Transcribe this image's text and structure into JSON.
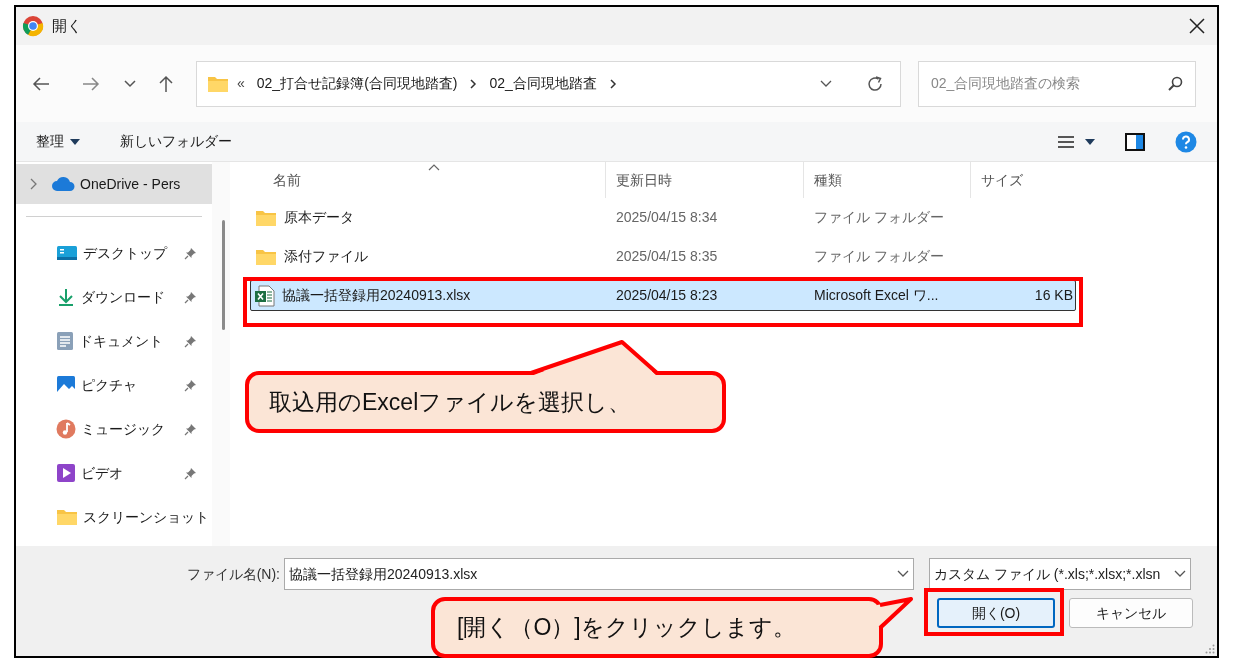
{
  "window": {
    "title": "開く"
  },
  "nav": {
    "prefix": "«",
    "breadcrumb": [
      {
        "label": "02_打合せ記録簿(合同現地踏査)"
      },
      {
        "label": "02_合同現地踏査"
      }
    ],
    "search": {
      "placeholder": "02_合同現地踏査の検索"
    }
  },
  "toolbar": {
    "organize": "整理",
    "new_folder": "新しいフォルダー"
  },
  "sidebar": {
    "items": [
      {
        "label": "OneDrive - Pers",
        "kind": "cloud",
        "selected": true,
        "pinned": false
      },
      {
        "label": "デスクトップ",
        "kind": "desktop",
        "selected": false,
        "pinned": true
      },
      {
        "label": "ダウンロード",
        "kind": "download",
        "selected": false,
        "pinned": true
      },
      {
        "label": "ドキュメント",
        "kind": "document",
        "selected": false,
        "pinned": true
      },
      {
        "label": "ピクチャ",
        "kind": "picture",
        "selected": false,
        "pinned": true
      },
      {
        "label": "ミュージック",
        "kind": "music",
        "selected": false,
        "pinned": true
      },
      {
        "label": "ビデオ",
        "kind": "video",
        "selected": false,
        "pinned": true
      },
      {
        "label": "スクリーンショット",
        "kind": "folder",
        "selected": false,
        "pinned": false
      }
    ]
  },
  "table": {
    "columns": [
      "名前",
      "更新日時",
      "種類",
      "サイズ"
    ],
    "rows": [
      {
        "name": "原本データ",
        "kind": "folder",
        "modified": "2025/04/15 8:34",
        "type": "ファイル フォルダー",
        "selected": false
      },
      {
        "name": "添付ファイル",
        "kind": "folder",
        "modified": "2025/04/15 8:35",
        "type": "ファイル フォルダー",
        "selected": false
      },
      {
        "name": "協議一括登録用20240913.xlsx",
        "kind": "excel",
        "modified": "2025/04/15 8:23",
        "type": "Microsoft Excel ワ...",
        "size": "16 KB",
        "selected": true
      }
    ]
  },
  "footer": {
    "filename_label": "ファイル名(N):",
    "filename": "協議一括登録用20240913.xlsx",
    "filter": "カスタム ファイル (*.xls;*.xlsx;*.xlsn",
    "buttons": [
      {
        "label": "開く(O)",
        "kind": "primary"
      },
      {
        "label": "キャンセル",
        "kind": "secondary"
      }
    ]
  },
  "annotations": [
    {
      "text": "取込用のExcelファイルを選択し、"
    },
    {
      "text": "[開く（O）]をクリックします。"
    }
  ]
}
